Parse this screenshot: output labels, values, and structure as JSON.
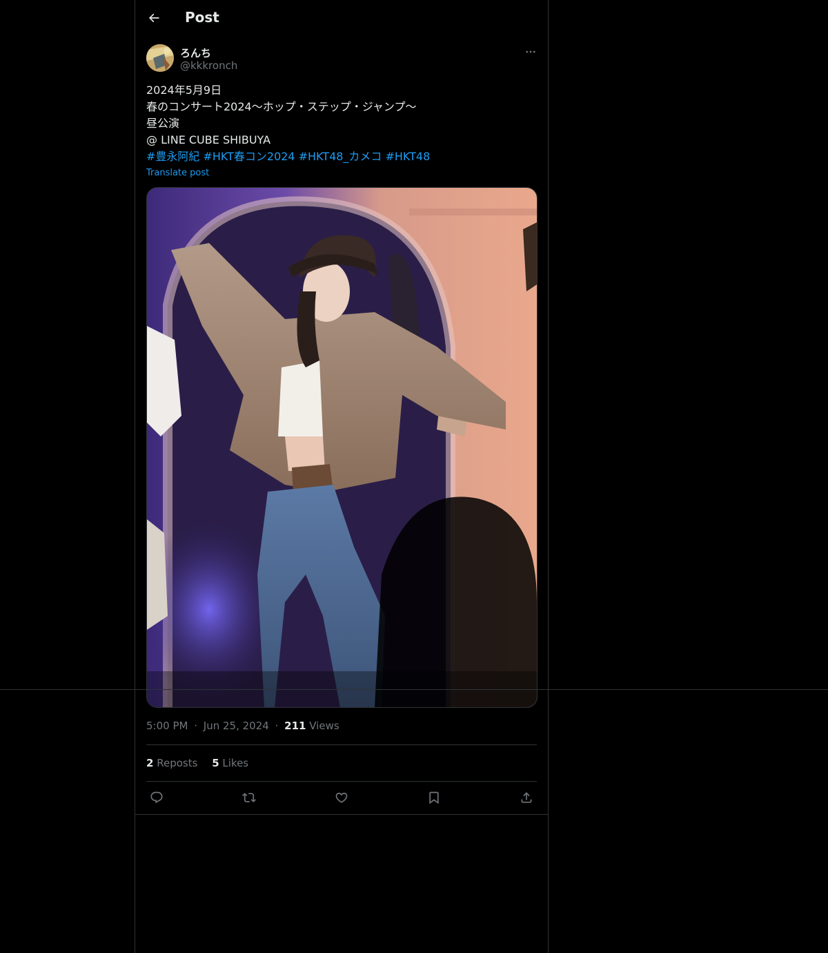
{
  "header": {
    "title": "Post"
  },
  "author": {
    "display_name": "ろんち",
    "handle": "@kkkronch"
  },
  "post": {
    "lines": [
      "2024年5月9日",
      "春のコンサート2024〜ホップ・ステップ・ジャンプ〜",
      "昼公演",
      "@ LINE CUBE SHIBUYA"
    ],
    "hashtags": [
      "#豊永阿紀",
      "#HKT春コン2024",
      "#HKT48_カメコ",
      "#HKT48"
    ],
    "translate_label": "Translate post"
  },
  "meta": {
    "time": "5:00 PM",
    "date": "Jun 25, 2024",
    "views_count": "211",
    "views_label": "Views",
    "separator": "·"
  },
  "stats": {
    "reposts_count": "2",
    "reposts_label": "Reposts",
    "likes_count": "5",
    "likes_label": "Likes"
  },
  "colors": {
    "background": "#000000",
    "text": "#e7e9ea",
    "muted": "#71767b",
    "accent": "#1d9bf0",
    "border": "#2f3336"
  },
  "icons": [
    "back-arrow-icon",
    "more-icon",
    "reply-icon",
    "repost-icon",
    "like-icon",
    "bookmark-icon",
    "share-icon"
  ]
}
